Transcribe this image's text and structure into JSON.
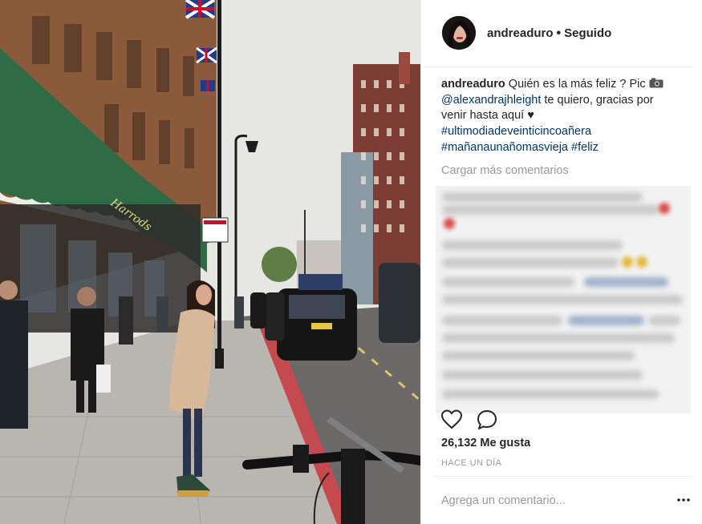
{
  "header": {
    "username": "andreaduro",
    "separator": "•",
    "follow_status": "Seguido"
  },
  "caption": {
    "username": "andreaduro",
    "text_part1": "Quién es la más feliz ? Pic",
    "mention": "@alexandrajhleight",
    "text_part2": "te quiero, gracias por venir hasta aquí ♥",
    "hashtag1": "#ultimodiadeveinticincoañera",
    "hashtag2": "#mañanaunañomasvieja",
    "hashtag3": "#feliz"
  },
  "comments": {
    "load_more_label": "Cargar más comentarios"
  },
  "actions": {
    "like_icon": "heart-icon",
    "comment_icon": "speech-bubble-icon"
  },
  "stats": {
    "likes": "26,132 Me gusta",
    "time_ago": "HACE UN DÍA"
  },
  "comment_input": {
    "placeholder": "Agrega un comentario..."
  },
  "colors": {
    "link": "#003569",
    "text": "#262626",
    "muted": "#999999",
    "awning_green": "#2f6b45"
  },
  "photo": {
    "shop_sign": "Harrods"
  }
}
